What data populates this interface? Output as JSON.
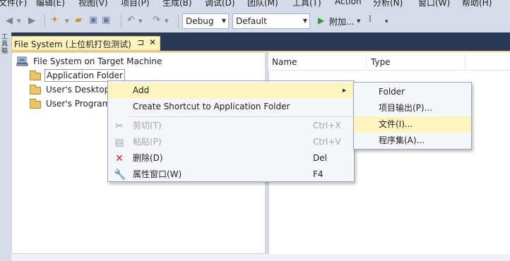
{
  "menubar": {
    "items": [
      "文件(F)",
      "编辑(E)",
      "视图(V)",
      "项目(P)",
      "生成(B)",
      "调试(D)",
      "团队(M)",
      "工具(T)",
      "Action",
      "分析(N)",
      "窗口(W)",
      "帮助(H)"
    ]
  },
  "toolbar": {
    "config_combo": "Debug",
    "platform_combo": "Default",
    "attach_label": "附加...",
    "left_strip_label": "工具箱"
  },
  "doc_tab": {
    "title": "File System (上位机打包测试)",
    "pin": "ㅁ",
    "close": "✕"
  },
  "tree": {
    "root": "File System on Target Machine",
    "items": [
      "Application Folder",
      "User's Desktop",
      "User's Programs Menu"
    ]
  },
  "list": {
    "columns": [
      "Name",
      "Type"
    ]
  },
  "context_menu": {
    "items": [
      {
        "label": "Add",
        "shortcut": "",
        "arrow": "▸"
      },
      {
        "label": "Create Shortcut to Application Folder",
        "shortcut": ""
      },
      {
        "label": "剪切(T)",
        "shortcut": "Ctrl+X"
      },
      {
        "label": "粘贴(P)",
        "shortcut": "Ctrl+V"
      },
      {
        "label": "删除(D)",
        "shortcut": "Del"
      },
      {
        "label": "属性窗口(W)",
        "shortcut": "F4"
      }
    ]
  },
  "submenu": {
    "items": [
      "Folder",
      "项目输出(P)...",
      "文件(I)...",
      "程序集(A)..."
    ]
  },
  "icons": {
    "cut": "scissors-icon",
    "paste": "clipboard-icon",
    "delete": "red-x-icon",
    "properties": "wrench-icon"
  },
  "colors": {
    "highlight": "#fdf4bf",
    "tab_strip": "#293955",
    "chrome": "#d6dbe9",
    "delete_red": "#d0241e",
    "run_green": "#2a9d34"
  }
}
